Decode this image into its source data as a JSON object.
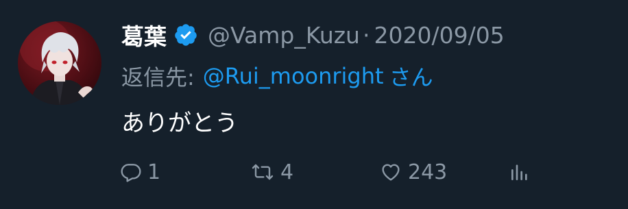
{
  "tweet": {
    "display_name": "葛葉",
    "verified": true,
    "handle": "@Vamp_Kuzu",
    "separator": "·",
    "date": "2020/09/05",
    "reply_prefix": "返信先:",
    "reply_to": "@Rui_moonright",
    "reply_suffix": "さん",
    "text": "ありがとう"
  },
  "actions": {
    "replies": "1",
    "retweets": "4",
    "likes": "243"
  },
  "colors": {
    "background": "#15202b",
    "secondary_text": "#8b98a5",
    "accent": "#1d9bf0",
    "primary_text": "#ffffff"
  },
  "icons": [
    "reply-icon",
    "retweet-icon",
    "like-icon",
    "analytics-icon",
    "verified-badge-icon"
  ]
}
